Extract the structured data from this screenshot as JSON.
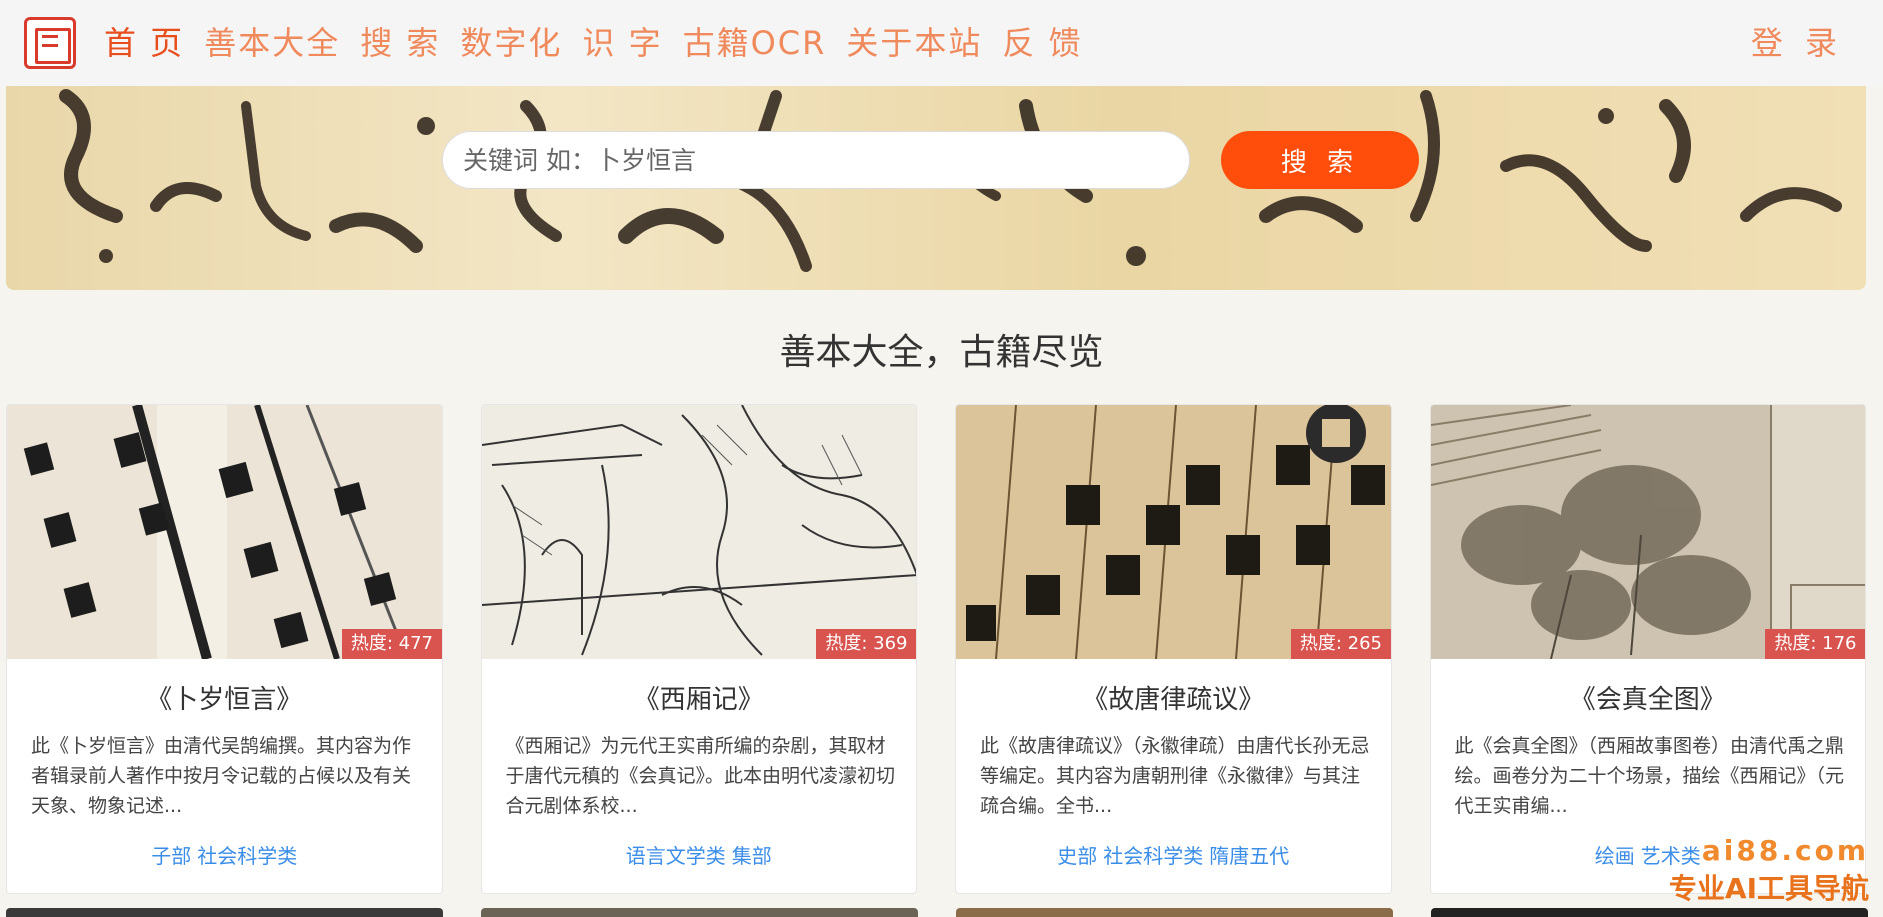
{
  "nav": {
    "items": [
      {
        "label": "首 页",
        "active": true
      },
      {
        "label": "善本大全"
      },
      {
        "label": "搜 索"
      },
      {
        "label": "数字化"
      },
      {
        "label": "识 字"
      },
      {
        "label": "古籍OCR"
      },
      {
        "label": "关于本站"
      },
      {
        "label": "反 馈"
      }
    ],
    "login": "登 录"
  },
  "search": {
    "placeholder": "关键词 如：卜岁恒言",
    "button": "搜 索"
  },
  "section_title": "善本大全，古籍尽览",
  "cards": [
    {
      "heat": "热度: 477",
      "title": "《卜岁恒言》",
      "desc": "此《卜岁恒言》由清代吴鹄编撰。其内容为作者辑录前人著作中按月令记载的占候以及有关天象、物象记述...",
      "tags": [
        "子部",
        "社会科学类"
      ]
    },
    {
      "heat": "热度: 369",
      "title": "《西厢记》",
      "desc": "《西厢记》为元代王实甫所编的杂剧，其取材于唐代元稹的《会真记》。此本由明代凌濛初切合元剧体系校...",
      "tags": [
        "语言文学类",
        "集部"
      ]
    },
    {
      "heat": "热度: 265",
      "title": "《故唐律疏议》",
      "desc": "此《故唐律疏议》（永徽律疏）由唐代长孙无忌等编定。其内容为唐朝刑律《永徽律》与其注疏合编。全书...",
      "tags": [
        "史部",
        "社会科学类",
        "隋唐五代"
      ]
    },
    {
      "heat": "热度: 176",
      "title": "《会真全图》",
      "desc": "此《会真全图》（西厢故事图卷）由清代禹之鼎绘。画卷分为二十个场景，描绘《西厢记》（元代王实甫编...",
      "tags": [
        "绘画",
        "艺术类"
      ]
    }
  ],
  "watermark": {
    "line1": "ai88.com",
    "line2": "专业AI工具导航"
  },
  "colors": {
    "nav_text": "#f08a5d",
    "nav_active": "#e84d1c",
    "search_button": "#ff4e0c",
    "badge": "#d9534f",
    "tag": "#3b8ee8"
  }
}
